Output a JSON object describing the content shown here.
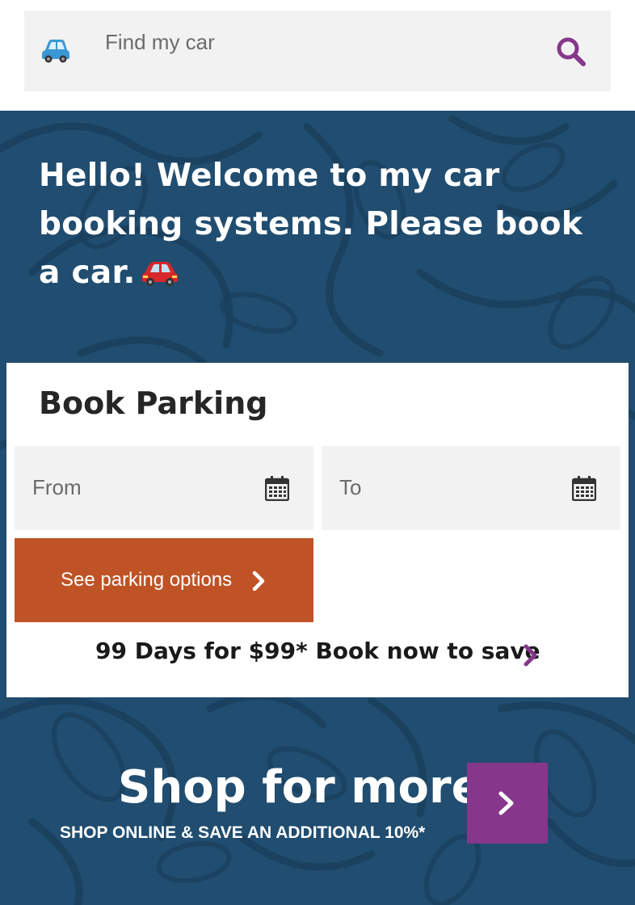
{
  "search": {
    "placeholder": "Find my car",
    "car_icon": "car-icon",
    "search_icon": "search-icon"
  },
  "hero": {
    "welcome_text": "Hello! Welcome to my car booking systems. Please book a car.",
    "welcome_icon": "red-car-icon"
  },
  "booking": {
    "title": "Book Parking",
    "from_label": "From",
    "to_label": "To",
    "calendar_icon": "calendar-icon",
    "submit_label": "See parking options",
    "promo_text": "99 Days for $99* Book now to save"
  },
  "shop": {
    "title": "Shop for more",
    "subtitle": "SHOP ONLINE & SAVE AN ADDITIONAL 10%*"
  },
  "colors": {
    "background_blue": "#204d70",
    "search_field": "#f2f2f2",
    "accent_purple": "#86378b",
    "button_orange": "#bf5326",
    "text_dark": "#262626"
  }
}
